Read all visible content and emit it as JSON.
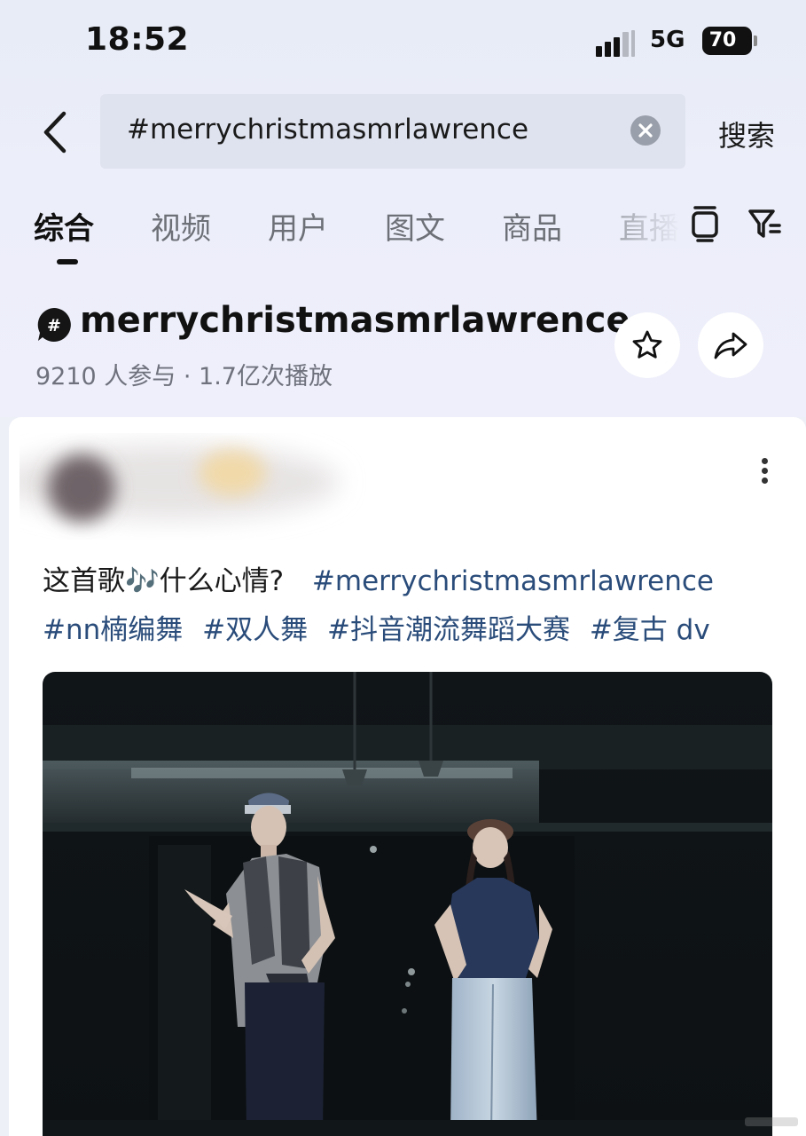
{
  "status_bar": {
    "time": "18:52",
    "network": "5G",
    "battery": "70"
  },
  "search": {
    "query": "#merrychristmasmrlawrence",
    "button_label": "搜索"
  },
  "tabs": [
    {
      "label": "综合",
      "active": true
    },
    {
      "label": "视频"
    },
    {
      "label": "用户"
    },
    {
      "label": "图文"
    },
    {
      "label": "商品"
    },
    {
      "label": "直播"
    }
  ],
  "topic": {
    "title": "merrychristmasmrlawrence",
    "stats": "9210 人参与 · 1.7亿次播放"
  },
  "post": {
    "caption_text": "这首歌🎶什么心情?",
    "hashtags": [
      "#merrychristmasmrlawrence",
      "#nn楠编舞",
      "#双人舞",
      "#抖音潮流舞蹈大赛",
      "#复古 dv"
    ]
  },
  "colors": {
    "hashtag": "#2a4c7a",
    "background": "#eef0f8",
    "card": "#ffffff"
  }
}
